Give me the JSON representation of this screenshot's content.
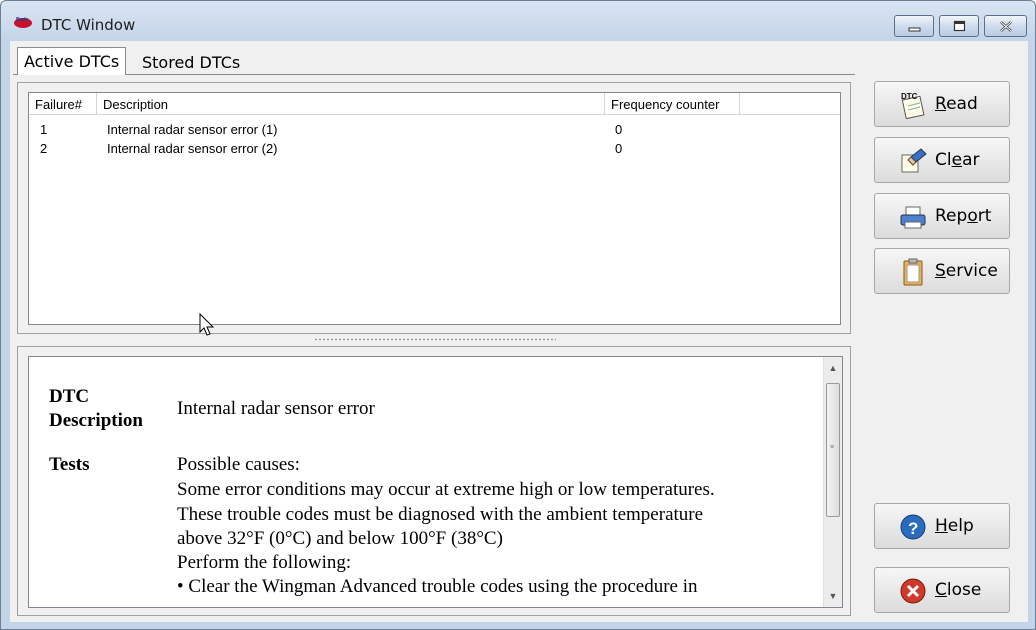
{
  "window": {
    "title": "DTC Window"
  },
  "tabs": [
    {
      "label": "Active DTCs",
      "active": true
    },
    {
      "label": "Stored DTCs",
      "active": false
    }
  ],
  "dtc_table": {
    "columns": [
      "Failure#",
      "Description",
      "Frequency counter"
    ],
    "rows": [
      {
        "failure": "1",
        "description": "Internal radar sensor error (1)",
        "frequency": "0"
      },
      {
        "failure": "2",
        "description": "Internal radar sensor error (2)",
        "frequency": "0"
      }
    ]
  },
  "details": {
    "dtc_label_1": "DTC",
    "dtc_label_2": "Description",
    "dtc_value": "Internal radar sensor error",
    "tests_label": "Tests",
    "tests_lines": [
      "Possible causes:",
      "Some error conditions may occur at extreme high or low temperatures.",
      "These trouble codes must be diagnosed with the ambient temperature",
      "above 32°F (0°C) and below 100°F (38°C)",
      "Perform the following:",
      "• Clear the Wingman Advanced trouble codes using the procedure in"
    ]
  },
  "buttons": {
    "read": {
      "label_pre": "",
      "label_u": "R",
      "label_post": "ead",
      "icon": "dtc-notepad-icon"
    },
    "clear": {
      "label_pre": "Cl",
      "label_u": "e",
      "label_post": "ar",
      "icon": "eraser-icon"
    },
    "report": {
      "label_pre": "Rep",
      "label_u": "o",
      "label_post": "rt",
      "icon": "printer-icon"
    },
    "service": {
      "label_pre": "",
      "label_u": "S",
      "label_post": "ervice",
      "icon": "clipboard-icon"
    },
    "help": {
      "label_pre": "",
      "label_u": "H",
      "label_post": "elp",
      "icon": "help-icon"
    },
    "close": {
      "label_pre": "",
      "label_u": "C",
      "label_post": "lose",
      "icon": "close-circle-icon"
    }
  },
  "colors": {
    "titlebar": "#c4d4e8",
    "help_blue": "#2a6bbf",
    "close_red": "#d03a2a"
  }
}
